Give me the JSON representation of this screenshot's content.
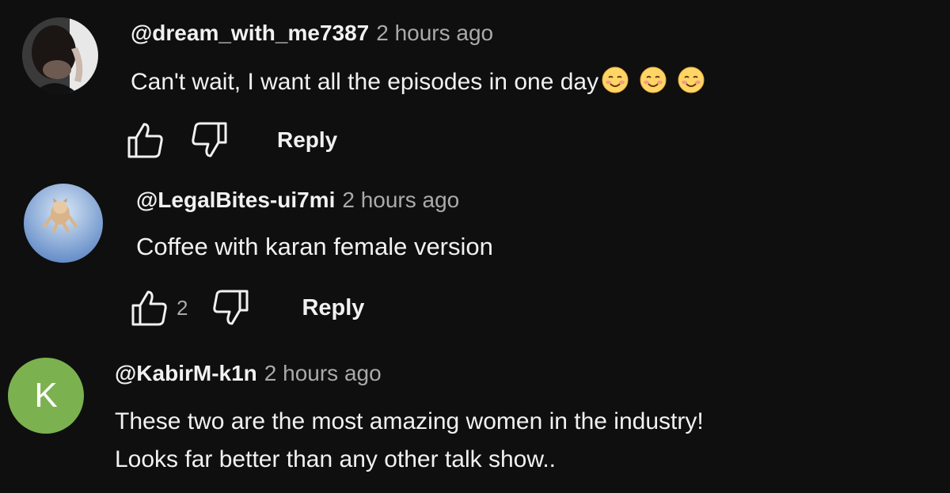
{
  "comments": [
    {
      "handle": "@dream_with_me7387",
      "time": "2 hours ago",
      "text": "Can't wait, I want all the episodes in one day",
      "emoji": [
        "smiling-face-emoji",
        "smiling-face-emoji",
        "smiling-face-emoji"
      ],
      "like_count": "",
      "reply_label": "Reply"
    },
    {
      "handle": "@LegalBites-ui7mi",
      "time": "2 hours ago",
      "text": "Coffee with karan female version",
      "like_count": "2",
      "reply_label": "Reply"
    },
    {
      "handle": "@KabirM-k1n",
      "time": "2 hours ago",
      "avatar_letter": "K",
      "text_lines": [
        "These two are the most amazing women in the industry!",
        "Looks far better than any other talk show.."
      ]
    }
  ],
  "colors": {
    "background": "#0f0f0f",
    "text": "#f1f1f1",
    "secondary_text": "#aaaaaa",
    "avatar_k": "#7bb24f"
  },
  "icons": {
    "like": "thumbs-up-icon",
    "dislike": "thumbs-down-icon"
  }
}
